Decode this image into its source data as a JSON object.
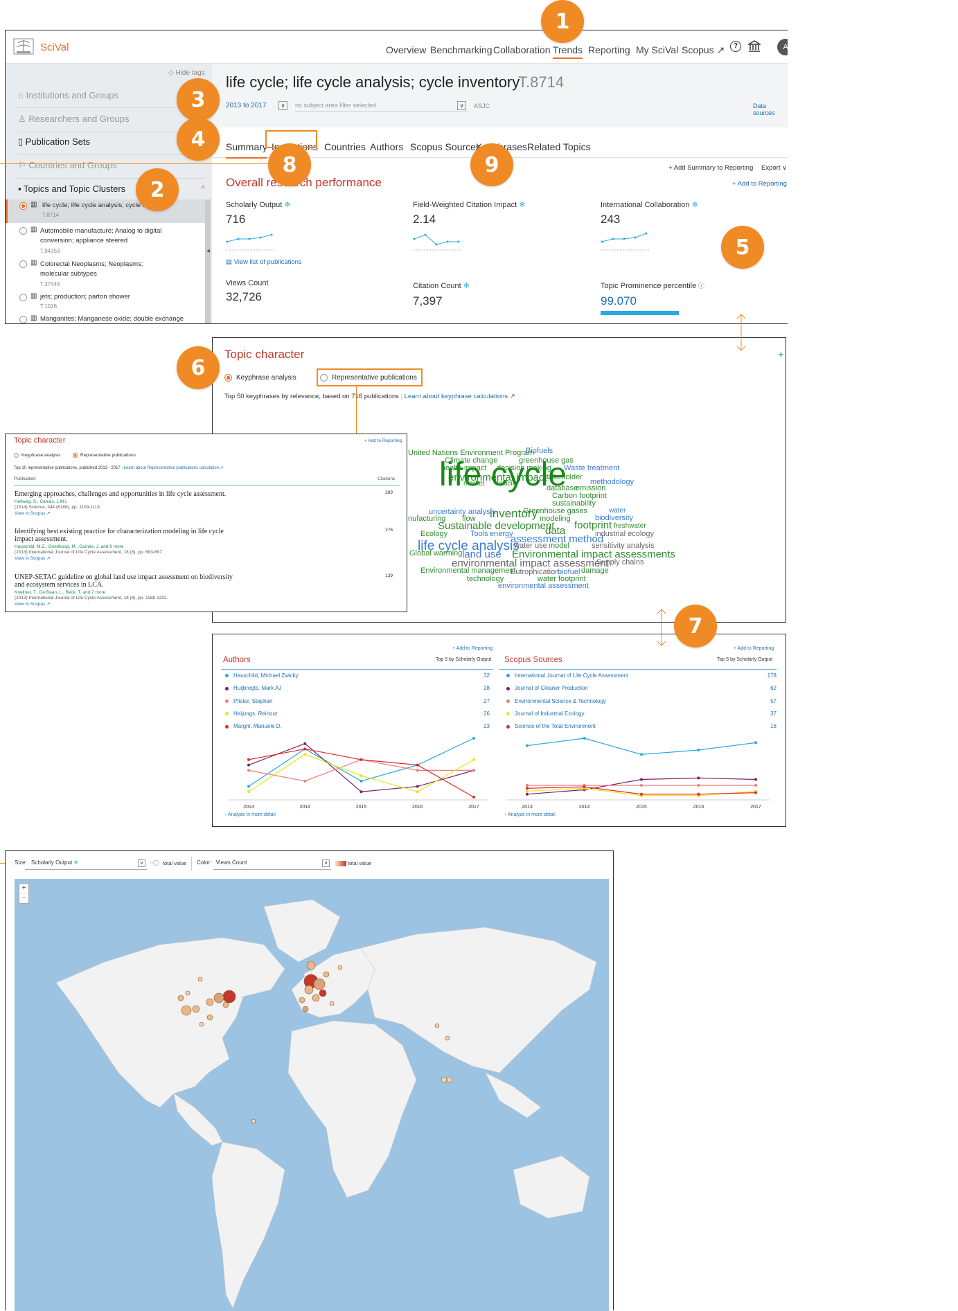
{
  "app": {
    "name": "SciVal"
  },
  "nav": {
    "items": [
      "Overview",
      "Benchmarking",
      "Collaboration",
      "Trends",
      "Reporting",
      "My SciVal",
      "Scopus ↗"
    ],
    "avatar": "A"
  },
  "sidebar": {
    "hide_tags": "Hide tags",
    "sections": [
      "Institutions and Groups",
      "Researchers and Groups",
      "Publication Sets",
      "Countries and Groups",
      "Topics and Topic Clusters"
    ],
    "topics": [
      {
        "name": "life cycle; life cycle analysis; cycle inventory",
        "id": "T.8714"
      },
      {
        "name": "Automobile manufacture; Analog to digital conversion; appliance steered",
        "id": "T.94353"
      },
      {
        "name": "Colorectal Neoplasms; Neoplasms; molecular subtypes",
        "id": "T.37444"
      },
      {
        "name": "jets; production; parton shower",
        "id": "T.1026"
      },
      {
        "name": "Manganites; Manganese oxide; double exchange",
        "id": ""
      }
    ]
  },
  "header": {
    "title": "life cycle; life cycle analysis; cycle inventory",
    "topic_id": "T.8714",
    "year_range": "2013 to 2017",
    "filter_placeholder": "no subject area filter selected",
    "asjc": "ASJC",
    "data_sources": "Data sources"
  },
  "tabs": [
    "Summary",
    "Institutions",
    "Countries",
    "Authors",
    "Scopus Sources",
    "Keyphrases",
    "Related Topics"
  ],
  "actions": {
    "add_summary": "+ Add Summary to Reporting",
    "export": "Export ∨",
    "add_reporting": "+ Add to Reporting"
  },
  "performance": {
    "title": "Overall research performance",
    "scholarly_output_label": "Scholarly Output",
    "scholarly_output": "716",
    "fwci_label": "Field-Weighted Citation Impact",
    "fwci": "2.14",
    "intl_label": "International Collaboration",
    "intl": "243",
    "view_list": "View list of publications",
    "views_label": "Views Count",
    "views": "32,726",
    "citations_label": "Citation Count",
    "citations": "7,397",
    "prominence_label": "Topic Prominence percentile",
    "prominence": "99.070",
    "prominence_fraction": 0.9907
  },
  "topic_character": {
    "title": "Topic character",
    "opt_keyphrase": "Keyphrase analysis",
    "opt_publications": "Representative publications",
    "subtitle_prefix": "Top 50 keyphrases by relevance, based on 716 publications",
    "learn_link": "Learn about keyphrase calculations ↗",
    "plus": "+"
  },
  "wordcloud": [
    {
      "t": "United Nations Environment Program",
      "c": "#2e8b2e",
      "s": 11
    },
    {
      "t": "Biofuels",
      "c": "#3a7bd5",
      "s": 11
    },
    {
      "t": "Climate change",
      "c": "#2e8b2e",
      "s": 11
    },
    {
      "t": "greenhouse gas",
      "c": "#2e8b2e",
      "s": 11
    },
    {
      "t": "health impact",
      "c": "#2e8b2e",
      "s": 11
    },
    {
      "t": "decision making",
      "c": "#2e8b2e",
      "s": 11
    },
    {
      "t": "Waste treatment",
      "c": "#3a7bd5",
      "s": 11
    },
    {
      "t": "environmental impact",
      "c": "#2e8b2e",
      "s": 15
    },
    {
      "t": "stakeholder",
      "c": "#2e8b2e",
      "s": 11
    },
    {
      "t": "market",
      "c": "#2e8b2e",
      "s": 10
    },
    {
      "t": "toxicity",
      "c": "#2e8b2e",
      "s": 10
    },
    {
      "t": "methodology",
      "c": "#3a7bd5",
      "s": 11
    },
    {
      "t": "life cycle",
      "c": "#1a8a1a",
      "s": 48
    },
    {
      "t": "database",
      "c": "#2e8b2e",
      "s": 11
    },
    {
      "t": "emission",
      "c": "#2e8b2e",
      "s": 11
    },
    {
      "t": "Carbon footprint",
      "c": "#2e8b2e",
      "s": 11
    },
    {
      "t": "sustainability",
      "c": "#2e8b2e",
      "s": 11
    },
    {
      "t": "uncertainty analysis",
      "c": "#3a7bd5",
      "s": 11
    },
    {
      "t": "Greenhouse gases",
      "c": "#2e8b2e",
      "s": 11
    },
    {
      "t": "water",
      "c": "#3a7bd5",
      "s": 10
    },
    {
      "t": "nufacturing",
      "c": "#2e8b2e",
      "s": 11
    },
    {
      "t": "flow",
      "c": "#2e8b2e",
      "s": 11
    },
    {
      "t": "inventory",
      "c": "#2e8b2e",
      "s": 17
    },
    {
      "t": "modeling",
      "c": "#2e8b2e",
      "s": 11
    },
    {
      "t": "biodiversity",
      "c": "#3a7bd5",
      "s": 11
    },
    {
      "t": "Sustainable development",
      "c": "#2e8b2e",
      "s": 15
    },
    {
      "t": "footprint",
      "c": "#2e8b2e",
      "s": 15
    },
    {
      "t": "freshwater",
      "c": "#2e8b2e",
      "s": 10
    },
    {
      "t": "Ecology",
      "c": "#2e8b2e",
      "s": 11
    },
    {
      "t": "Tools",
      "c": "#3a7bd5",
      "s": 11
    },
    {
      "t": "energy",
      "c": "#3a7bd5",
      "s": 11
    },
    {
      "t": "data",
      "c": "#2e8b2e",
      "s": 15
    },
    {
      "t": "industrial ecology",
      "c": "#666666",
      "s": 11
    },
    {
      "t": "assessment method",
      "c": "#3a7bd5",
      "s": 15
    },
    {
      "t": "life cycle analysis",
      "c": "#3a7bd5",
      "s": 19
    },
    {
      "t": "water use",
      "c": "#666666",
      "s": 11
    },
    {
      "t": "model",
      "c": "#2e8b2e",
      "s": 11
    },
    {
      "t": "sensitivity analysis",
      "c": "#666666",
      "s": 11
    },
    {
      "t": "Global warming",
      "c": "#2e8b2e",
      "s": 11
    },
    {
      "t": "land use",
      "c": "#3a7bd5",
      "s": 15
    },
    {
      "t": "Environmental impact assessments",
      "c": "#2e8b2e",
      "s": 15
    },
    {
      "t": "environmental impact assessment",
      "c": "#666666",
      "s": 15
    },
    {
      "t": "Supply chains",
      "c": "#666666",
      "s": 11
    },
    {
      "t": "Environmental management",
      "c": "#2e8b2e",
      "s": 11
    },
    {
      "t": "Eutrophication",
      "c": "#666666",
      "s": 11
    },
    {
      "t": "biofuel",
      "c": "#3a7bd5",
      "s": 11
    },
    {
      "t": "damage",
      "c": "#2e8b2e",
      "s": 11
    },
    {
      "t": "technology",
      "c": "#2e8b2e",
      "s": 11
    },
    {
      "t": "water footprint",
      "c": "#2e8b2e",
      "s": 11
    },
    {
      "t": "environmental assessment",
      "c": "#3a7bd5",
      "s": 11
    }
  ],
  "rep_panel": {
    "title": "Topic character",
    "add_reporting": "+ Add to Reporting",
    "opt_keyphrase": "Keyphrase analysis",
    "opt_publications": "Representative publications",
    "subtitle": "Top 10 representative publications, published 2013 - 2017",
    "learn_link": "Learn about Representative publications calculation ↗",
    "col_publication": "Publication",
    "col_citations": "Citations",
    "pubs": [
      {
        "title": "Emerging approaches, challenges and opportunities in life cycle assessment.",
        "authors": "Hellweg, S., Canals, L.M.I.",
        "journal": "(2014) Science, 344 (6188), pp. 1109-1113.",
        "link": "View in Scopus ↗",
        "citations": "289"
      },
      {
        "title": "Identifying best existing practice for characterization modeling in life cycle impact assessment.",
        "authors": "Hauschild, M.Z., Goedkoop, M., Guinée, J. and 9 more",
        "journal": "(2013) International Journal of Life Cycle Assessment, 18 (3), pp. 683-697.",
        "link": "View in Scopus ↗",
        "citations": "276"
      },
      {
        "title": "UNEP-SETAC guideline on global land use impact assessment on biodiversity and ecosystem services in LCA.",
        "authors": "Koellner, T., De Baan, L., Beck, T. and 7 more",
        "journal": "(2013) International Journal of Life Cycle Assessment, 18 (6), pp. 1188-1202.",
        "link": "View in Scopus ↗",
        "citations": "139"
      }
    ]
  },
  "authors_panel": {
    "title": "Authors",
    "add_reporting": "+ Add to Reporting",
    "top5": "Top 5 by Scholarly Output",
    "analyze": "Analyze in more detail",
    "rows": [
      {
        "name": "Hauschild, Michael Zwicky",
        "value": "32",
        "color": "#2aa8e0"
      },
      {
        "name": "Huijbregts, Mark AJ",
        "value": "28",
        "color": "#7b1f6a"
      },
      {
        "name": "Pfister, Stephan",
        "value": "27",
        "color": "#f07b7b"
      },
      {
        "name": "Heijungs, Reinout",
        "value": "26",
        "color": "#e6e619"
      },
      {
        "name": "Margni, Manuele D.",
        "value": "23",
        "color": "#e02a2a"
      }
    ]
  },
  "sources_panel": {
    "title": "Scopus Sources",
    "add_reporting": "+ Add to Reporting",
    "top5": "Top 5 by Scholarly Output",
    "analyze": "Analyze in more detail",
    "rows": [
      {
        "name": "International Journal of Life Cycle Assessment",
        "value": "178",
        "color": "#2aa8e0"
      },
      {
        "name": "Journal of Cleaner Production",
        "value": "62",
        "color": "#7b1f6a"
      },
      {
        "name": "Environmental Science & Technology",
        "value": "57",
        "color": "#f07b7b"
      },
      {
        "name": "Journal of Industrial Ecology",
        "value": "37",
        "color": "#e6e619"
      },
      {
        "name": "Science of the Total Environment",
        "value": "16",
        "color": "#e02a2a"
      }
    ]
  },
  "chart_data": [
    {
      "type": "line",
      "categories": [
        "2013",
        "2014",
        "2015",
        "2016",
        "2017"
      ],
      "series": [
        {
          "name": "Hauschild, Michael Zwicky",
          "values": [
            2,
            9,
            3,
            6,
            11
          ]
        },
        {
          "name": "Huijbregts, Mark AJ",
          "values": [
            6,
            10,
            1,
            2,
            5
          ]
        },
        {
          "name": "Pfister, Stephan",
          "values": [
            5,
            3,
            7,
            5,
            5
          ]
        },
        {
          "name": "Heijungs, Reinout",
          "values": [
            1,
            8,
            4,
            1,
            7
          ]
        },
        {
          "name": "Margni, Manuele D.",
          "values": [
            7,
            9,
            7,
            6,
            0
          ]
        }
      ]
    },
    {
      "type": "line",
      "categories": [
        "2013",
        "2014",
        "2015",
        "2016",
        "2017"
      ],
      "series": [
        {
          "name": "International Journal of Life Cycle Assessment",
          "values": [
            35,
            40,
            29,
            32,
            37
          ]
        },
        {
          "name": "Journal of Cleaner Production",
          "values": [
            2,
            5,
            12,
            13,
            12
          ]
        },
        {
          "name": "Environmental Science & Technology",
          "values": [
            8,
            8,
            8,
            8,
            8
          ]
        },
        {
          "name": "Journal of Industrial Ecology",
          "values": [
            4,
            6,
            1,
            1,
            4
          ]
        },
        {
          "name": "Science of the Total Environment",
          "values": [
            6,
            7,
            2,
            2,
            3
          ]
        }
      ]
    }
  ],
  "map_panel": {
    "size_label": "Size:",
    "size_value": "Scholarly Output",
    "size_legend": "total value",
    "color_label": "Color:",
    "color_value": "Views Count",
    "color_legend": "total value",
    "zoom_in": "+",
    "zoom_out": "−"
  },
  "callouts": [
    "1",
    "2",
    "3",
    "4",
    "5",
    "6",
    "7",
    "8",
    "9"
  ],
  "colors": {
    "accent": "#f08a24",
    "title_red": "#c0392b",
    "link": "#1f6fb3",
    "bar": "#2aa8e0",
    "ocean": "#9dc3e2"
  }
}
